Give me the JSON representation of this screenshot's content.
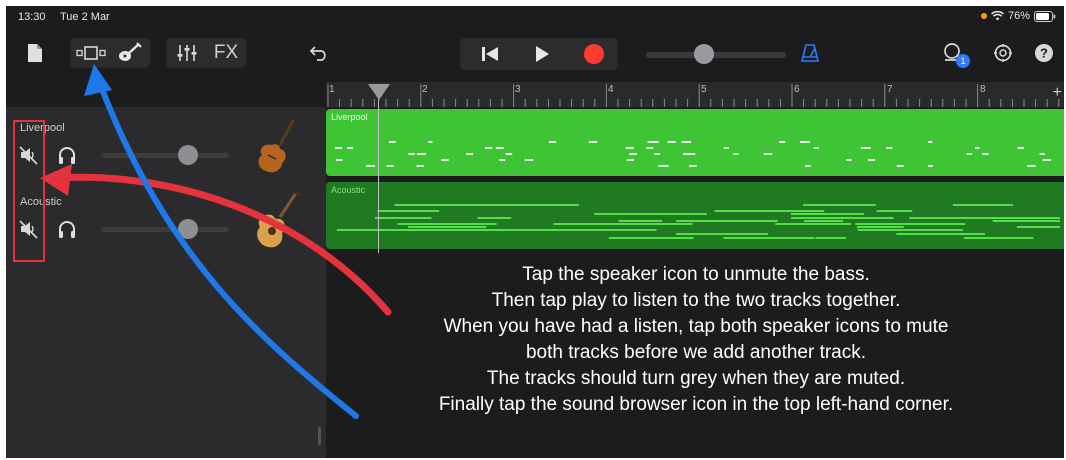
{
  "status_bar": {
    "time": "13:30",
    "date": "Tue 2 Mar",
    "battery": "76%"
  },
  "toolbar": {
    "fx_label": "FX",
    "notification_badge": "1"
  },
  "ruler": {
    "bars": [
      "1",
      "2",
      "3",
      "4",
      "5",
      "6",
      "7",
      "8"
    ],
    "add_label": "+"
  },
  "tracks": [
    {
      "name": "Liverpool",
      "instrument": "violin-bass-icon",
      "color": "#3fc435"
    },
    {
      "name": "Acoustic",
      "instrument": "acoustic-guitar-icon",
      "color": "#1f7a22"
    }
  ],
  "regions": {
    "liverpool_label": "Liverpool",
    "acoustic_label": "Acoustic"
  },
  "instructions": [
    "Tap the speaker icon to unmute the bass.",
    "Then tap play to listen to the two tracks together.",
    "When you have had a listen, tap both speaker icons to mute",
    "both tracks before we add another track.",
    "The tracks should turn grey when they are muted.",
    "Finally tap the sound browser icon in the top left-hand corner."
  ],
  "colors": {
    "record": "#ff3b30",
    "metronome": "#2f7bff",
    "annotation_red": "#e5333d",
    "annotation_blue": "#1f78e8"
  }
}
